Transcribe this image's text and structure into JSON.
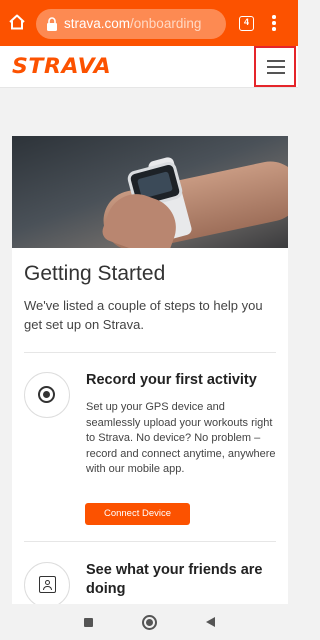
{
  "browser": {
    "url_domain": "strava.com",
    "url_path": "/onboarding",
    "tab_count": "4",
    "accent_color": "#fc5200"
  },
  "header": {
    "logo_text": "STRAVA",
    "menu_icon": "hamburger-menu-icon"
  },
  "card": {
    "title": "Getting Started",
    "intro": "We've listed a couple of steps to help you get set up on Strava.",
    "steps": [
      {
        "icon": "record-icon",
        "title": "Record your first activity",
        "description": "Set up your GPS device and seamlessly upload your workouts right to Strava. No device? No problem – record and connect anytime, anywhere with our mobile app.",
        "button_label": "Connect Device"
      },
      {
        "icon": "profile-contact-icon",
        "title": "See what your friends are doing"
      }
    ]
  },
  "system_nav": {
    "icons": [
      "recents-square-icon",
      "home-circle-icon",
      "back-triangle-icon"
    ]
  }
}
